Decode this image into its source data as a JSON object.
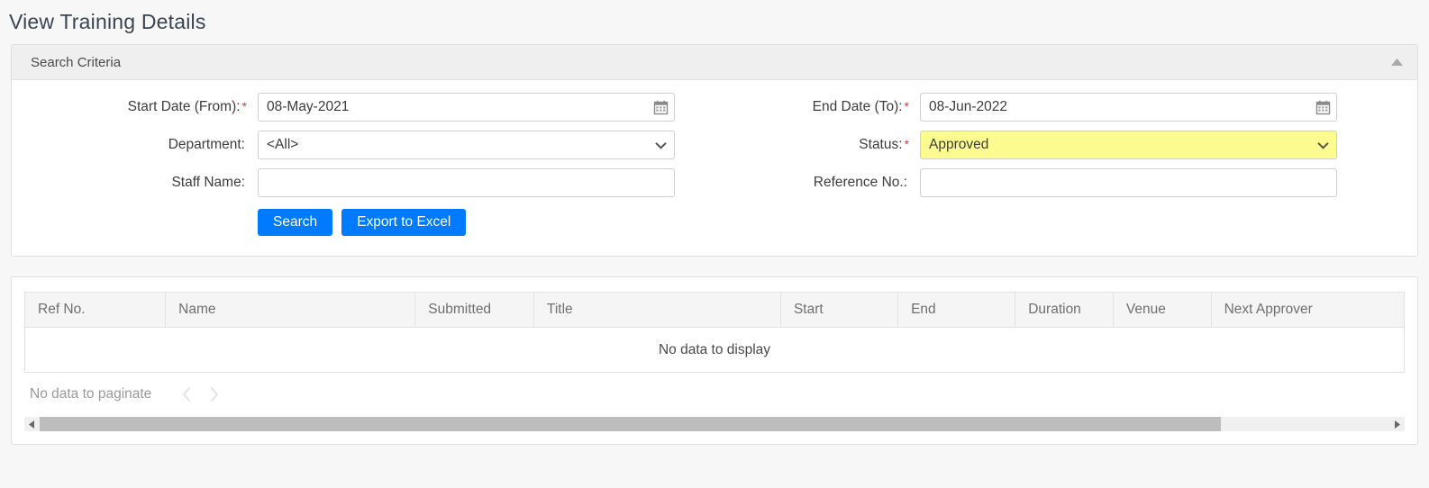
{
  "page": {
    "title": "View Training Details",
    "accent_color": "#007bff",
    "required_color": "#e8312f",
    "highlight_color": "#fbfb8f"
  },
  "search_panel": {
    "header_title": "Search Criteria",
    "collapse_icon": "triangle-up-icon",
    "fields": {
      "start_date": {
        "label": "Start Date (From):",
        "required": "*",
        "value": "08-May-2021",
        "placeholder": "",
        "icon": "calendar-icon"
      },
      "end_date": {
        "label": "End Date (To):",
        "required": "*",
        "value": "08-Jun-2022",
        "placeholder": "",
        "icon": "calendar-icon"
      },
      "department": {
        "label": "Department:",
        "required": "",
        "value": "<All>",
        "options": [
          "<All>"
        ],
        "icon": "chevron-down-icon"
      },
      "status": {
        "label": "Status:",
        "required": "*",
        "value": "Approved",
        "options": [
          "Approved"
        ],
        "icon": "chevron-down-icon",
        "highlighted": true
      },
      "staff_name": {
        "label": "Staff Name:",
        "required": "",
        "value": "",
        "placeholder": ""
      },
      "reference_no": {
        "label": "Reference No.:",
        "required": "",
        "value": "",
        "placeholder": ""
      }
    },
    "buttons": {
      "search": "Search",
      "export": "Export to Excel"
    }
  },
  "results_panel": {
    "columns": [
      "Ref No.",
      "Name",
      "Submitted",
      "Title",
      "Start",
      "End",
      "Duration",
      "Venue",
      "Next Approver"
    ],
    "rows": [],
    "empty_message": "No data to display",
    "pagination": {
      "text": "No data to paginate",
      "prev_icon": "chevron-left-icon",
      "next_icon": "chevron-right-icon"
    },
    "scrollbar": {
      "left_icon": "triangle-left-icon",
      "right_icon": "triangle-right-icon",
      "thumb_percent": 87.5
    }
  }
}
